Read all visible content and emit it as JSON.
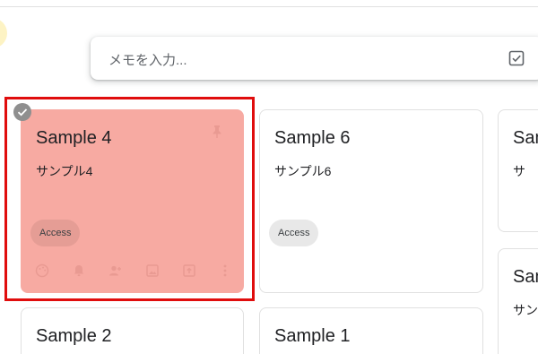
{
  "note_input": {
    "placeholder": "メモを入力...",
    "icon": "checkbox-icon"
  },
  "cards": [
    {
      "title": "Sample 4",
      "body": "サンプル4",
      "label": "Access",
      "selected": true,
      "pin_icon": "pin-icon",
      "toolbar_icons": [
        "palette-icon",
        "reminder-icon",
        "collaborator-icon",
        "image-icon",
        "archive-icon",
        "more-icon"
      ]
    },
    {
      "title": "Sample 6",
      "body": "サンプル6",
      "label": "Access",
      "selected": false
    },
    {
      "title": "Sam",
      "body": "サ",
      "selected": false
    },
    {
      "title": "Sam",
      "body": "サン",
      "selected": false
    },
    {
      "title": "Sample 2",
      "selected": false
    },
    {
      "title": "Sample 1",
      "selected": false
    }
  ],
  "colors": {
    "selected_card": "#f7aaa2",
    "selection_frame": "#e00d0d"
  }
}
